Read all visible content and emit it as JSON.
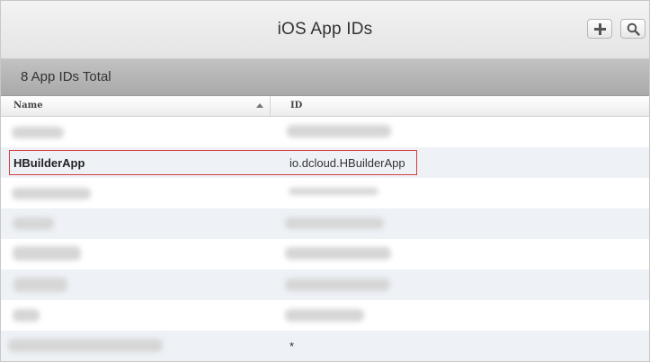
{
  "header": {
    "title": "iOS App IDs",
    "add_icon": "plus-icon",
    "search_icon": "search-icon"
  },
  "summary": {
    "text": "8 App IDs Total"
  },
  "columns": {
    "name": "Name",
    "id": "ID"
  },
  "rows": [
    {
      "name": "",
      "id": ""
    },
    {
      "name": "HBuilderApp",
      "id": "io.dcloud.HBuilderApp"
    },
    {
      "name": "",
      "id": ""
    },
    {
      "name": "",
      "id": ""
    },
    {
      "name": "",
      "id": ""
    },
    {
      "name": "",
      "id": ""
    },
    {
      "name": "",
      "id": ""
    },
    {
      "name": "",
      "id": "*"
    }
  ],
  "colors": {
    "highlight": "#d34040",
    "row_alt": "#eef2f7"
  }
}
